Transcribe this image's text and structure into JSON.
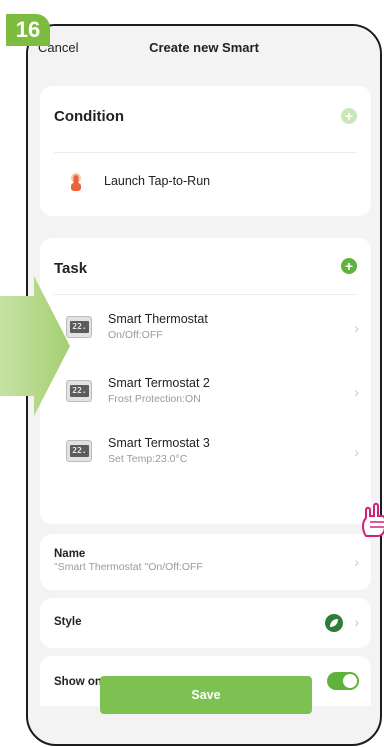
{
  "step_number": "16",
  "header": {
    "cancel_label": "Cancel",
    "title": "Create new Smart"
  },
  "condition": {
    "heading": "Condition",
    "item_label": "Launch Tap-to-Run"
  },
  "task": {
    "heading": "Task",
    "items": [
      {
        "name": "Smart Thermostat",
        "detail": "On/Off:OFF",
        "display": "22.",
        "icon": "thermostat-icon"
      },
      {
        "name": "Smart Termostat 2",
        "detail": "Frost Protection:ON",
        "display": "22.",
        "icon": "thermostat-icon"
      },
      {
        "name": "Smart Termostat 3",
        "detail": "Set Temp:23.0°C",
        "display": "22.",
        "icon": "thermostat-icon"
      }
    ]
  },
  "name_setting": {
    "label": "Name",
    "value": "\"Smart Thermostat \"On/Off:OFF"
  },
  "style_setting": {
    "label": "Style",
    "color": "#2f7d38"
  },
  "home_page_setting": {
    "label": "Show on Home Page",
    "enabled": true
  },
  "save_label": "Save",
  "colors": {
    "accent": "#5fb33a",
    "badge": "#7cbc3e",
    "save": "#7cc152",
    "arrow": "#b7d98a"
  }
}
